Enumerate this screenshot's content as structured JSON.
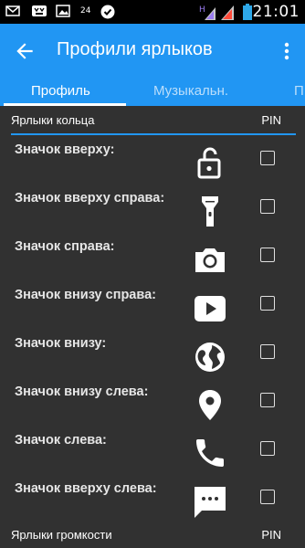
{
  "status_bar": {
    "time": "21:01",
    "network_label": "24",
    "icons": [
      "mail-icon",
      "cat-icon",
      "image-icon",
      "check-circle-icon",
      "signal-icon",
      "battery-icon"
    ]
  },
  "app_bar": {
    "title": "Профили ярлыков",
    "back_icon": "arrow-back-icon",
    "menu_icon": "more-vert-icon",
    "color": "#2196f3"
  },
  "tabs": [
    {
      "label": "Профиль",
      "active": true
    },
    {
      "label": "Музыкальн.",
      "active": false
    },
    {
      "label": "П",
      "active": false
    }
  ],
  "ring_section": {
    "title": "Ярлыки кольца",
    "pin_label": "PIN",
    "items": [
      {
        "label": "Значок вверху:",
        "icon": "lock-open-icon",
        "pin": false
      },
      {
        "label": "Значок вверху справа:",
        "icon": "flashlight-icon",
        "pin": false
      },
      {
        "label": "Значок справа:",
        "icon": "camera-icon",
        "pin": false
      },
      {
        "label": "Значок внизу справа:",
        "icon": "youtube-play-icon",
        "pin": false
      },
      {
        "label": "Значок внизу:",
        "icon": "globe-icon",
        "pin": false
      },
      {
        "label": "Значок внизу слева:",
        "icon": "map-pin-icon",
        "pin": false
      },
      {
        "label": "Значок слева:",
        "icon": "phone-icon",
        "pin": false
      },
      {
        "label": "Значок вверху слева:",
        "icon": "message-icon",
        "pin": false
      }
    ]
  },
  "volume_section": {
    "title": "Ярлыки громкости",
    "pin_label": "PIN"
  }
}
